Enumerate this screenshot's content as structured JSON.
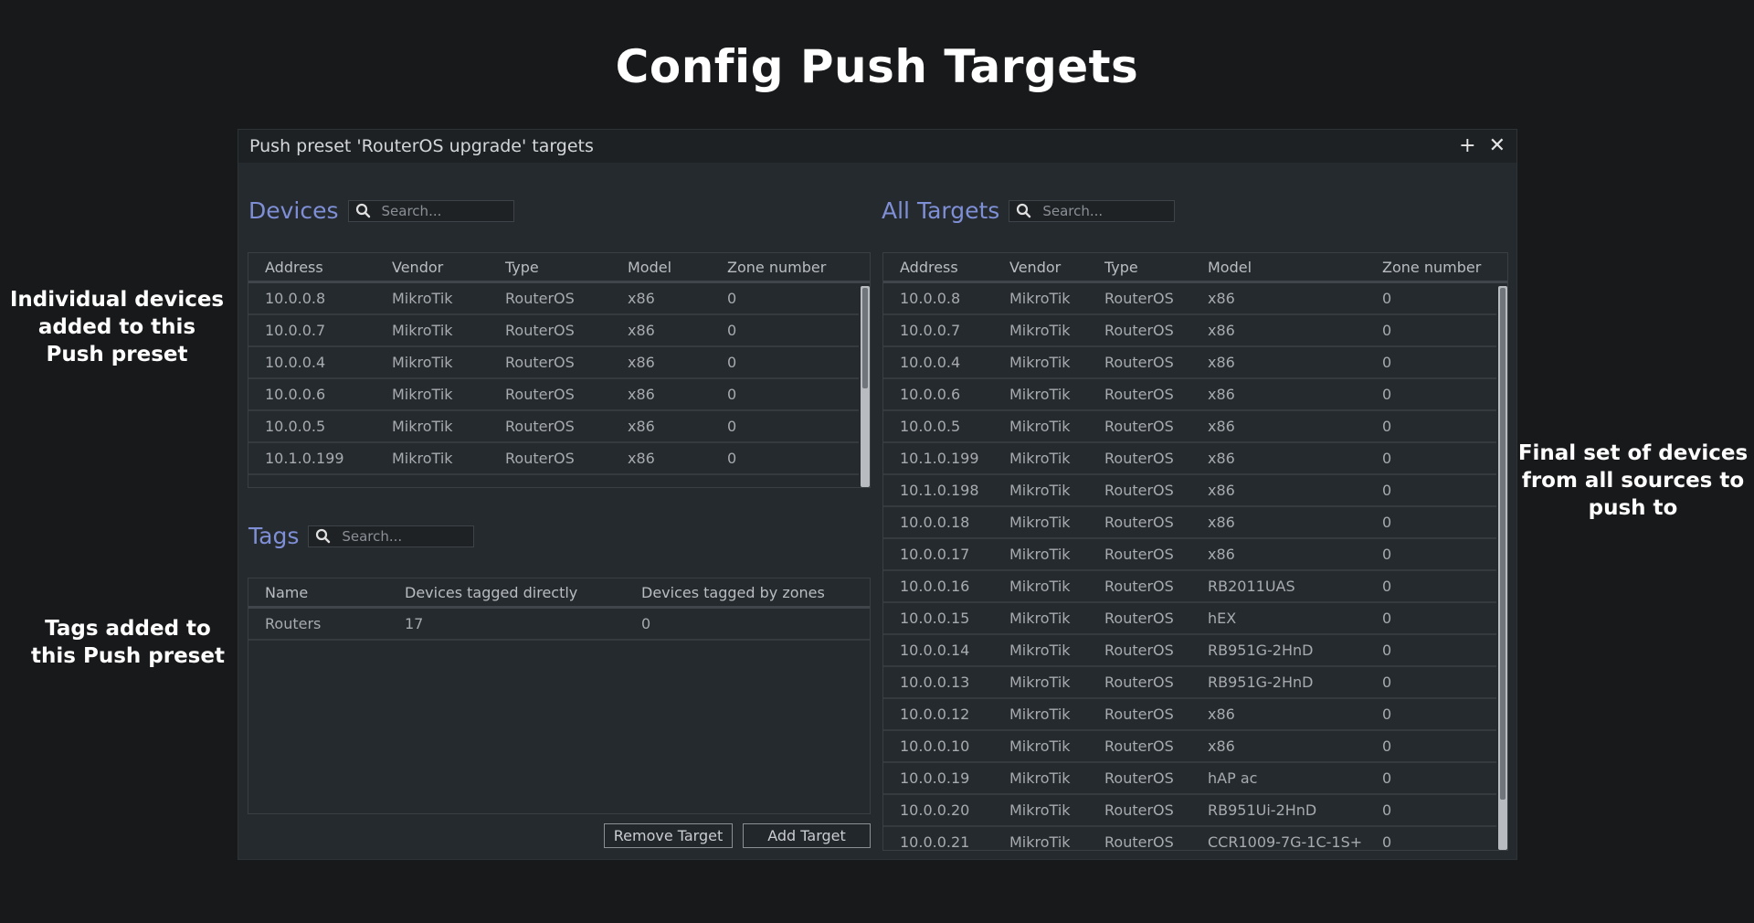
{
  "page_title": "Config Push Targets",
  "annotations": {
    "devices": "Individual devices added to this Push preset",
    "tags": "Tags added to this Push preset",
    "all_targets": "Final set of devices from all sources to push to"
  },
  "window": {
    "title": "Push preset 'RouterOS upgrade' targets",
    "add_icon": "+",
    "close_icon": "✕"
  },
  "devices": {
    "title": "Devices",
    "search_placeholder": "Search...",
    "columns": [
      "Address",
      "Vendor",
      "Type",
      "Model",
      "Zone number"
    ],
    "rows": [
      [
        "10.0.0.8",
        "MikroTik",
        "RouterOS",
        "x86",
        "0"
      ],
      [
        "10.0.0.7",
        "MikroTik",
        "RouterOS",
        "x86",
        "0"
      ],
      [
        "10.0.0.4",
        "MikroTik",
        "RouterOS",
        "x86",
        "0"
      ],
      [
        "10.0.0.6",
        "MikroTik",
        "RouterOS",
        "x86",
        "0"
      ],
      [
        "10.0.0.5",
        "MikroTik",
        "RouterOS",
        "x86",
        "0"
      ],
      [
        "10.1.0.199",
        "MikroTik",
        "RouterOS",
        "x86",
        "0"
      ]
    ]
  },
  "tags": {
    "title": "Tags",
    "search_placeholder": "Search...",
    "columns": [
      "Name",
      "Devices tagged directly",
      "Devices tagged by zones"
    ],
    "rows": [
      [
        "Routers",
        "17",
        "0"
      ]
    ]
  },
  "all_targets": {
    "title": "All Targets",
    "search_placeholder": "Search...",
    "columns": [
      "Address",
      "Vendor",
      "Type",
      "Model",
      "Zone number"
    ],
    "rows": [
      [
        "10.0.0.8",
        "MikroTik",
        "RouterOS",
        "x86",
        "0"
      ],
      [
        "10.0.0.7",
        "MikroTik",
        "RouterOS",
        "x86",
        "0"
      ],
      [
        "10.0.0.4",
        "MikroTik",
        "RouterOS",
        "x86",
        "0"
      ],
      [
        "10.0.0.6",
        "MikroTik",
        "RouterOS",
        "x86",
        "0"
      ],
      [
        "10.0.0.5",
        "MikroTik",
        "RouterOS",
        "x86",
        "0"
      ],
      [
        "10.1.0.199",
        "MikroTik",
        "RouterOS",
        "x86",
        "0"
      ],
      [
        "10.1.0.198",
        "MikroTik",
        "RouterOS",
        "x86",
        "0"
      ],
      [
        "10.0.0.18",
        "MikroTik",
        "RouterOS",
        "x86",
        "0"
      ],
      [
        "10.0.0.17",
        "MikroTik",
        "RouterOS",
        "x86",
        "0"
      ],
      [
        "10.0.0.16",
        "MikroTik",
        "RouterOS",
        "RB2011UAS",
        "0"
      ],
      [
        "10.0.0.15",
        "MikroTik",
        "RouterOS",
        "hEX",
        "0"
      ],
      [
        "10.0.0.14",
        "MikroTik",
        "RouterOS",
        "RB951G-2HnD",
        "0"
      ],
      [
        "10.0.0.13",
        "MikroTik",
        "RouterOS",
        "RB951G-2HnD",
        "0"
      ],
      [
        "10.0.0.12",
        "MikroTik",
        "RouterOS",
        "x86",
        "0"
      ],
      [
        "10.0.0.10",
        "MikroTik",
        "RouterOS",
        "x86",
        "0"
      ],
      [
        "10.0.0.19",
        "MikroTik",
        "RouterOS",
        "hAP ac",
        "0"
      ],
      [
        "10.0.0.20",
        "MikroTik",
        "RouterOS",
        "RB951Ui-2HnD",
        "0"
      ],
      [
        "10.0.0.21",
        "MikroTik",
        "RouterOS",
        "CCR1009-7G-1C-1S+",
        "0"
      ]
    ]
  },
  "buttons": {
    "remove_target": "Remove Target",
    "add_target": "Add Target"
  },
  "colors": {
    "background": "#18191b",
    "panel": "#252a2e",
    "section_title": "#7f8fd6"
  },
  "icons": {
    "search": "search-icon",
    "add": "plus-icon",
    "close": "close-icon"
  }
}
